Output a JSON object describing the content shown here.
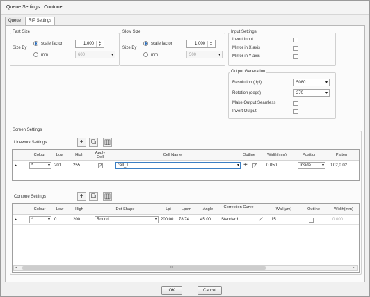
{
  "window": {
    "title": "Queue Settings : Contone"
  },
  "tabs": [
    {
      "label": "Queue"
    },
    {
      "label": "RIP Settings"
    }
  ],
  "fast_size": {
    "group": "Fast Size",
    "size_by": "Size By",
    "opt_scale": "scale factor",
    "opt_mm": "mm",
    "scale_value": "1.000",
    "mm_value": "600"
  },
  "slow_size": {
    "group": "Slow Size",
    "size_by": "Size By",
    "opt_scale": "scale factor",
    "opt_mm": "mm",
    "scale_value": "1.000",
    "mm_value": "500"
  },
  "input_settings": {
    "group": "Input Settings",
    "invert_input": "Invert Input",
    "mirror_x": "Mirror in X axis",
    "mirror_y": "Mirror in Y axis"
  },
  "output_generation": {
    "group": "Output Generation",
    "resolution_label": "Resolution (dpi)",
    "resolution_value": "5080",
    "rotation_label": "Rotation (degs)",
    "rotation_value": "270",
    "seamless": "Make Output Seamless",
    "invert_output": "Invert Output"
  },
  "screen_settings": {
    "group": "Screen Settings"
  },
  "linework": {
    "title": "Linework Settings",
    "columns": [
      "Colour",
      "Low",
      "High",
      "Apply Cell",
      "Cell Name",
      "Outline",
      "Width(mm)",
      "Position",
      "Pattern"
    ],
    "row": {
      "colour": "*",
      "low": "201",
      "high": "255",
      "cell_name": "cell_1",
      "width": "0.050",
      "position": "Inside",
      "pattern": "0.02,0.02"
    }
  },
  "contone": {
    "title": "Contone Settings",
    "columns": [
      "Colour",
      "Low",
      "High",
      "Dot Shape",
      "Lpi",
      "Lpcm",
      "Angle",
      "Correction Curve",
      "Wall(µm)",
      "Outline",
      "Width(mm)"
    ],
    "row": {
      "colour": "*",
      "low": "0",
      "high": "200",
      "dot_shape": "Round",
      "lpi": "200.00",
      "lpcm": "78.74",
      "angle": "45.00",
      "curve": "Standard",
      "wall": "15",
      "width": "0.000"
    }
  },
  "scrollbar_label": "III",
  "buttons": {
    "ok": "OK",
    "cancel": "Cancel"
  }
}
